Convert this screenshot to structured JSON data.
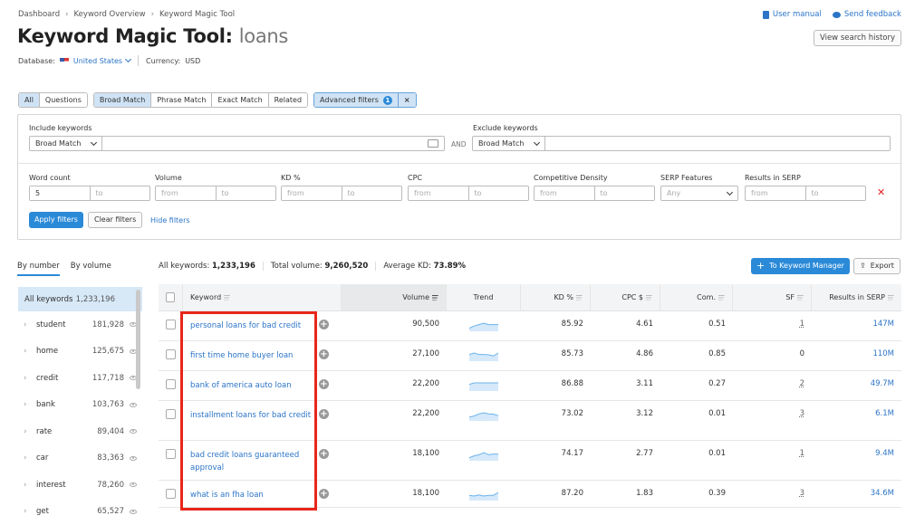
{
  "breadcrumb": [
    "Dashboard",
    "Keyword Overview",
    "Keyword Magic Tool"
  ],
  "header": {
    "title": "Keyword Magic Tool:",
    "query": "loans",
    "user_manual": "User manual",
    "send_feedback": "Send feedback",
    "view_history": "View search history"
  },
  "database": {
    "label": "Database:",
    "country": "United States",
    "currency_label": "Currency:",
    "currency": "USD"
  },
  "match_tabs": {
    "group1": [
      "All",
      "Questions"
    ],
    "group2": [
      "Broad Match",
      "Phrase Match",
      "Exact Match",
      "Related"
    ],
    "advanced": "Advanced filters",
    "advanced_count": "1",
    "close": "×"
  },
  "filters": {
    "include_label": "Include keywords",
    "include_match": "Broad Match",
    "and": "AND",
    "exclude_label": "Exclude keywords",
    "exclude_match": "Broad Match",
    "fields": [
      {
        "label": "Word count",
        "from": "5",
        "to": "to"
      },
      {
        "label": "Volume",
        "from": "from",
        "to": "to"
      },
      {
        "label": "KD %",
        "from": "from",
        "to": "to"
      },
      {
        "label": "CPC",
        "from": "from",
        "to": "to"
      },
      {
        "label": "Competitive Density",
        "from": "from",
        "to": "to"
      }
    ],
    "serp_features": {
      "label": "SERP Features",
      "value": "Any"
    },
    "results_in_serp": {
      "label": "Results in SERP",
      "from": "from",
      "to": "to"
    },
    "apply": "Apply filters",
    "clear": "Clear filters",
    "hide": "Hide filters"
  },
  "view_tabs": [
    "By number",
    "By volume"
  ],
  "stats": {
    "all_label": "All keywords:",
    "all": "1,233,196",
    "vol_label": "Total volume:",
    "vol": "9,260,520",
    "kd_label": "Average KD:",
    "kd": "73.89%"
  },
  "actions": {
    "keyword_manager": "To Keyword Manager",
    "export": "Export"
  },
  "sidebar": {
    "all_label": "All keywords",
    "all_count": "1,233,196",
    "items": [
      {
        "word": "student",
        "count": "181,928"
      },
      {
        "word": "home",
        "count": "125,675"
      },
      {
        "word": "credit",
        "count": "117,718"
      },
      {
        "word": "bank",
        "count": "103,763"
      },
      {
        "word": "rate",
        "count": "89,404"
      },
      {
        "word": "car",
        "count": "83,363"
      },
      {
        "word": "interest",
        "count": "78,260"
      },
      {
        "word": "get",
        "count": "65,527"
      }
    ]
  },
  "table": {
    "headers": {
      "keyword": "Keyword",
      "volume": "Volume",
      "trend": "Trend",
      "kd": "KD %",
      "cpc": "CPC $",
      "com": "Com.",
      "sf": "SF",
      "serp": "Results in SERP"
    },
    "rows": [
      {
        "keyword": "personal loans for bad credit",
        "volume": "90,500",
        "kd": "85.92",
        "cpc": "4.61",
        "com": "0.51",
        "sf": "1",
        "serp": "147M",
        "trend": [
          0.3,
          0.6,
          0.8,
          1,
          0.8,
          0.8,
          0.8
        ]
      },
      {
        "keyword": "first time home buyer loan",
        "volume": "27,100",
        "kd": "85.73",
        "cpc": "4.86",
        "com": "0.85",
        "sf": "0",
        "serp": "110M",
        "trend": [
          0.8,
          1,
          0.8,
          0.8,
          0.75,
          0.6,
          1
        ]
      },
      {
        "keyword": "bank of america auto loan",
        "volume": "22,200",
        "kd": "86.88",
        "cpc": "3.11",
        "com": "0.27",
        "sf": "2",
        "serp": "49.7M",
        "trend": [
          0.8,
          1,
          1,
          1,
          1,
          1,
          1
        ]
      },
      {
        "keyword": "installment loans for bad credit",
        "volume": "22,200",
        "kd": "73.02",
        "cpc": "3.12",
        "com": "0.01",
        "sf": "3",
        "serp": "6.1M",
        "trend": [
          0.4,
          0.55,
          0.85,
          1,
          0.85,
          0.8,
          0.6
        ]
      },
      {
        "keyword": "bad credit loans guaranteed approval",
        "volume": "18,100",
        "kd": "74.17",
        "cpc": "2.77",
        "com": "0.01",
        "sf": "1",
        "serp": "9.4M",
        "trend": [
          0.3,
          0.55,
          0.7,
          1,
          0.7,
          0.8,
          0.8
        ]
      },
      {
        "keyword": "what is an fha loan",
        "volume": "18,100",
        "kd": "87.20",
        "cpc": "1.83",
        "com": "0.39",
        "sf": "3",
        "serp": "34.6M",
        "trend": [
          0.6,
          0.5,
          0.65,
          0.5,
          0.6,
          0.6,
          1
        ]
      }
    ]
  }
}
